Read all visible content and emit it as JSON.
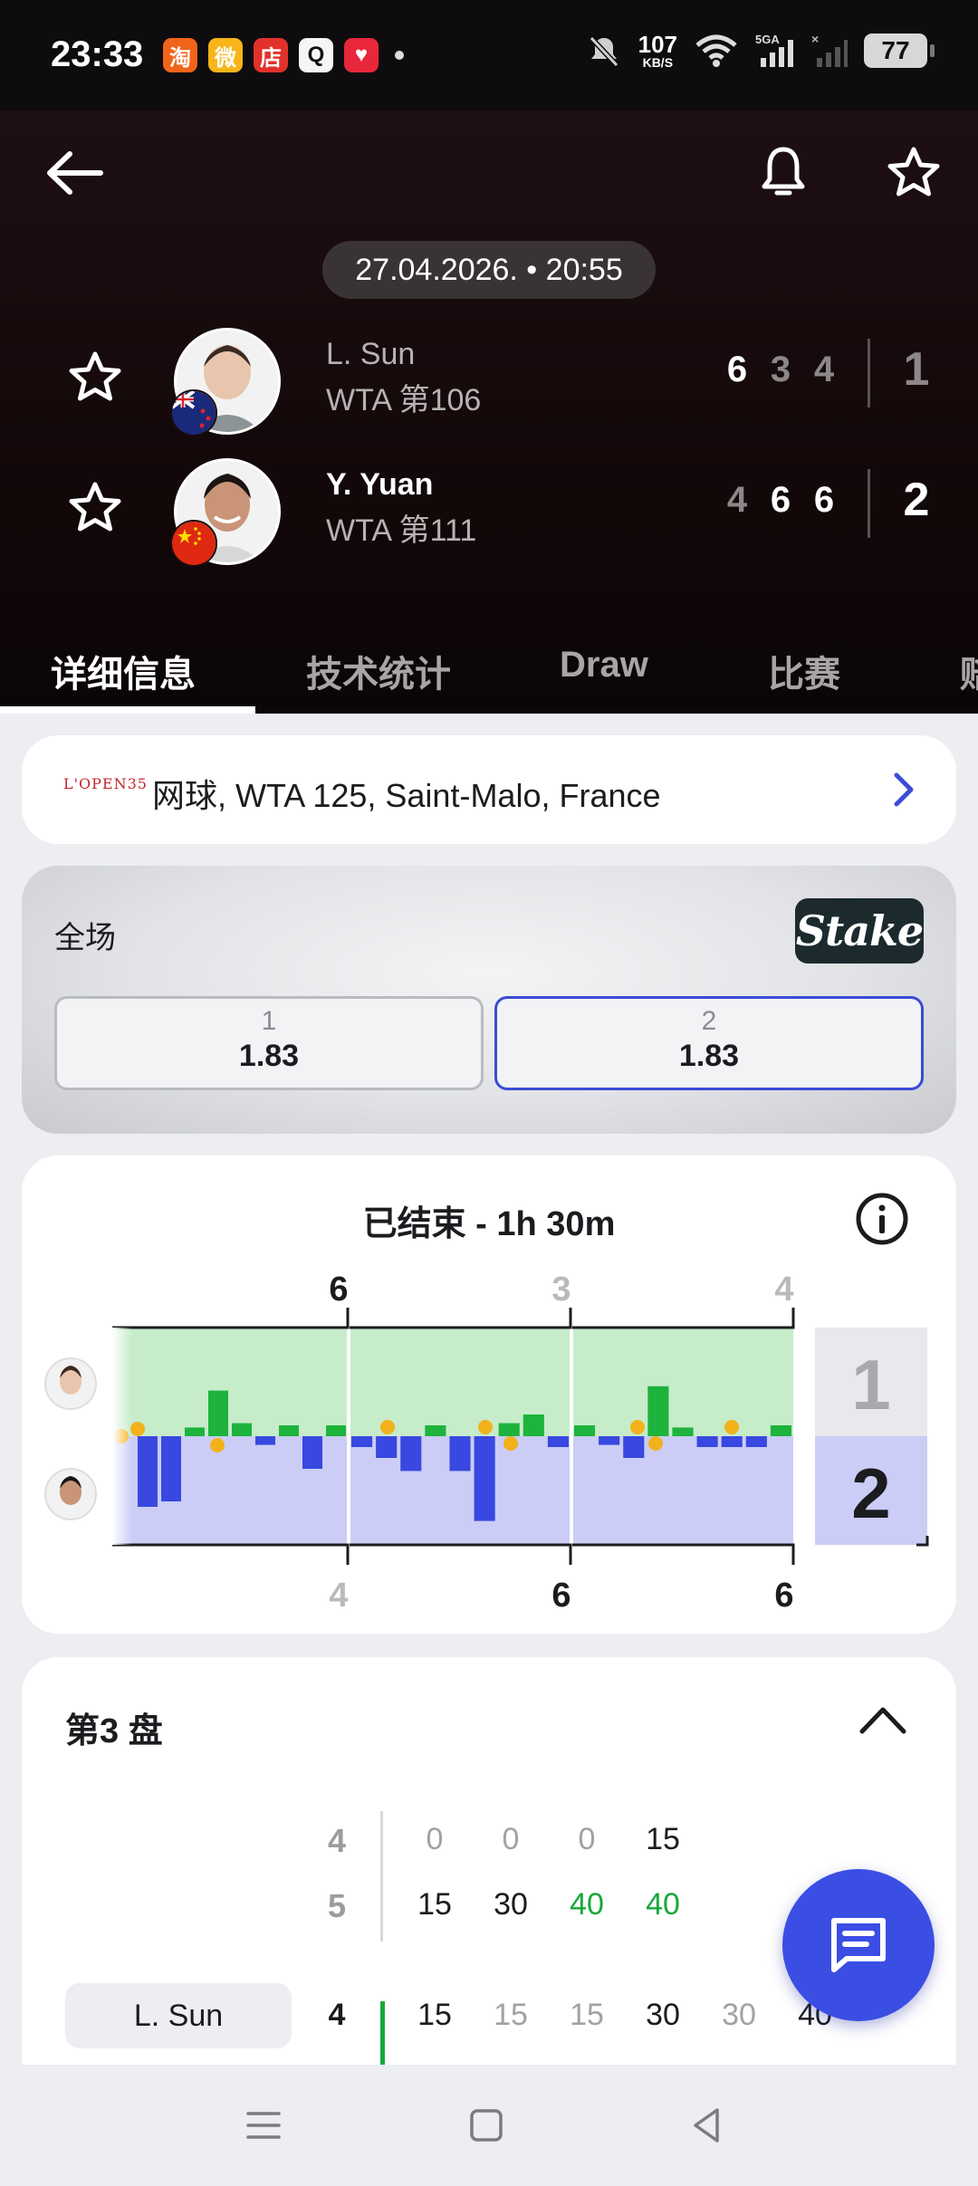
{
  "status_bar": {
    "time": "23:33",
    "apps": [
      {
        "icon": "taobao-app-icon",
        "glyph": "淘",
        "color": "#f2641a"
      },
      {
        "icon": "weibo-app-icon",
        "glyph": "微",
        "color": "#f7b51a"
      },
      {
        "icon": "store-app-icon",
        "glyph": "店",
        "color": "#e2312b"
      },
      {
        "icon": "qq-app-icon",
        "glyph": "Q",
        "color": "#f5f5f5"
      },
      {
        "icon": "health-app-icon",
        "glyph": "♥",
        "color": "#e8283a"
      }
    ],
    "net_speed_value": "107",
    "net_speed_unit": "KB/S",
    "battery": "77"
  },
  "header": {
    "datetime": "27.04.2026. • 20:55",
    "players": [
      {
        "name": "L. Sun",
        "rank": "WTA 第106",
        "sets": [
          "6",
          "3",
          "4"
        ],
        "sets_won": [
          true,
          false,
          false
        ],
        "total": "1",
        "winner": false,
        "flag": "new-zealand-flag-icon"
      },
      {
        "name": "Y. Yuan",
        "rank": "WTA 第111",
        "sets": [
          "4",
          "6",
          "6"
        ],
        "sets_won": [
          false,
          true,
          true
        ],
        "total": "2",
        "winner": true,
        "flag": "china-flag-icon"
      }
    ],
    "tabs": [
      "详细信息",
      "技术统计",
      "Draw",
      "比赛",
      "赔"
    ],
    "active_tab": 0
  },
  "tournament": {
    "logo_text": "L'OPEN35",
    "title": "网球, WTA 125, Saint-Malo, France"
  },
  "odds": {
    "label": "全场",
    "bookmaker": "Stake",
    "options": [
      {
        "name": "1",
        "value": "1.83",
        "selected": false
      },
      {
        "name": "2",
        "value": "1.83",
        "selected": true
      }
    ]
  },
  "momentum": {
    "title": "已结束 - 1h 30m",
    "set_scores_top": [
      "6",
      "3",
      "4"
    ],
    "set_scores_bottom": [
      "4",
      "6",
      "6"
    ],
    "top_won": [
      true,
      false,
      false
    ],
    "legend_top": "1",
    "legend_bottom": "2",
    "colors": {
      "p1_bar": "#1db33d",
      "p2_bar": "#3848e0",
      "p1_bg": "#c6ecca",
      "p2_bg": "#cbcdf6",
      "break_ball": "#f2b21b"
    },
    "bars": [
      [
        0,
        -0.65,
        -0.6,
        0.08,
        0.42,
        0.12,
        -0.08,
        0.1,
        -0.3,
        0.1
      ],
      [
        -0.1,
        -0.2,
        -0.32,
        0.1,
        -0.32,
        -0.78,
        0.12,
        0.2,
        -0.1
      ],
      [
        0.1,
        -0.08,
        -0.2,
        0.46,
        0.08,
        -0.1,
        -0.1,
        -0.1,
        0.1
      ]
    ]
  },
  "set3": {
    "title": "第3 盘",
    "rows_top": {
      "game_scores": [
        "4",
        "5"
      ],
      "points_row1": [
        "0",
        "0",
        "0",
        "15"
      ],
      "points_row2": [
        "15",
        "30",
        "40",
        "40"
      ]
    },
    "current": {
      "player": "L. Sun",
      "game_score": "4",
      "points": [
        "15",
        "15",
        "15",
        "30",
        "30",
        "40"
      ]
    }
  }
}
